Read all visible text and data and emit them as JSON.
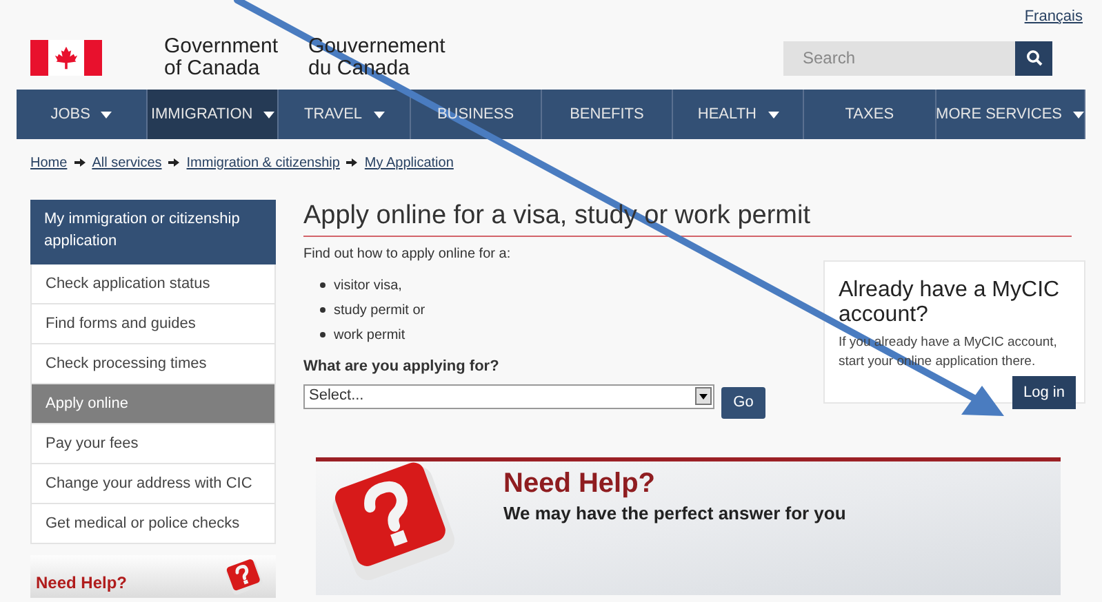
{
  "header": {
    "language_link": "Français",
    "title_en": [
      "Government",
      "of Canada"
    ],
    "title_fr": [
      "Gouvernement",
      "du Canada"
    ],
    "search": {
      "placeholder": "Search"
    }
  },
  "nav": [
    {
      "label": "JOBS",
      "has_menu": true,
      "selected": false
    },
    {
      "label": "IMMIGRATION",
      "has_menu": true,
      "selected": true
    },
    {
      "label": "TRAVEL",
      "has_menu": true,
      "selected": false
    },
    {
      "label": "BUSINESS",
      "has_menu": false,
      "selected": false
    },
    {
      "label": "BENEFITS",
      "has_menu": false,
      "selected": false
    },
    {
      "label": "HEALTH",
      "has_menu": true,
      "selected": false
    },
    {
      "label": "TAXES",
      "has_menu": false,
      "selected": false
    },
    {
      "label": "MORE SERVICES",
      "has_menu": true,
      "selected": false
    }
  ],
  "breadcrumb": [
    "Home",
    "All services",
    "Immigration & citizenship",
    "My Application"
  ],
  "sidebar": {
    "heading": "My immigration or citizenship application",
    "items": [
      {
        "label": "Check application status",
        "selected": false
      },
      {
        "label": "Find forms and guides",
        "selected": false
      },
      {
        "label": "Check processing times",
        "selected": false
      },
      {
        "label": "Apply online",
        "selected": true
      },
      {
        "label": "Pay your fees",
        "selected": false
      },
      {
        "label": "Change your address with CIC",
        "selected": false
      },
      {
        "label": "Get medical or police checks",
        "selected": false
      }
    ],
    "banner_title": "Need Help?"
  },
  "main": {
    "title": "Apply online for a visa, study or work permit",
    "intro": "Find out how to apply online for a:",
    "list": [
      "visitor visa,",
      "study permit or",
      "work permit"
    ],
    "question": "What are you applying for?",
    "select_value": "Select...",
    "go_button": "Go",
    "help_banner": {
      "title": "Need Help?",
      "subtitle": "We may have the perfect answer for you"
    }
  },
  "account_card": {
    "title": "Already have a MyCIC account?",
    "text": "If you already have a MyCIC account, start your online application there.",
    "button": "Log in"
  }
}
